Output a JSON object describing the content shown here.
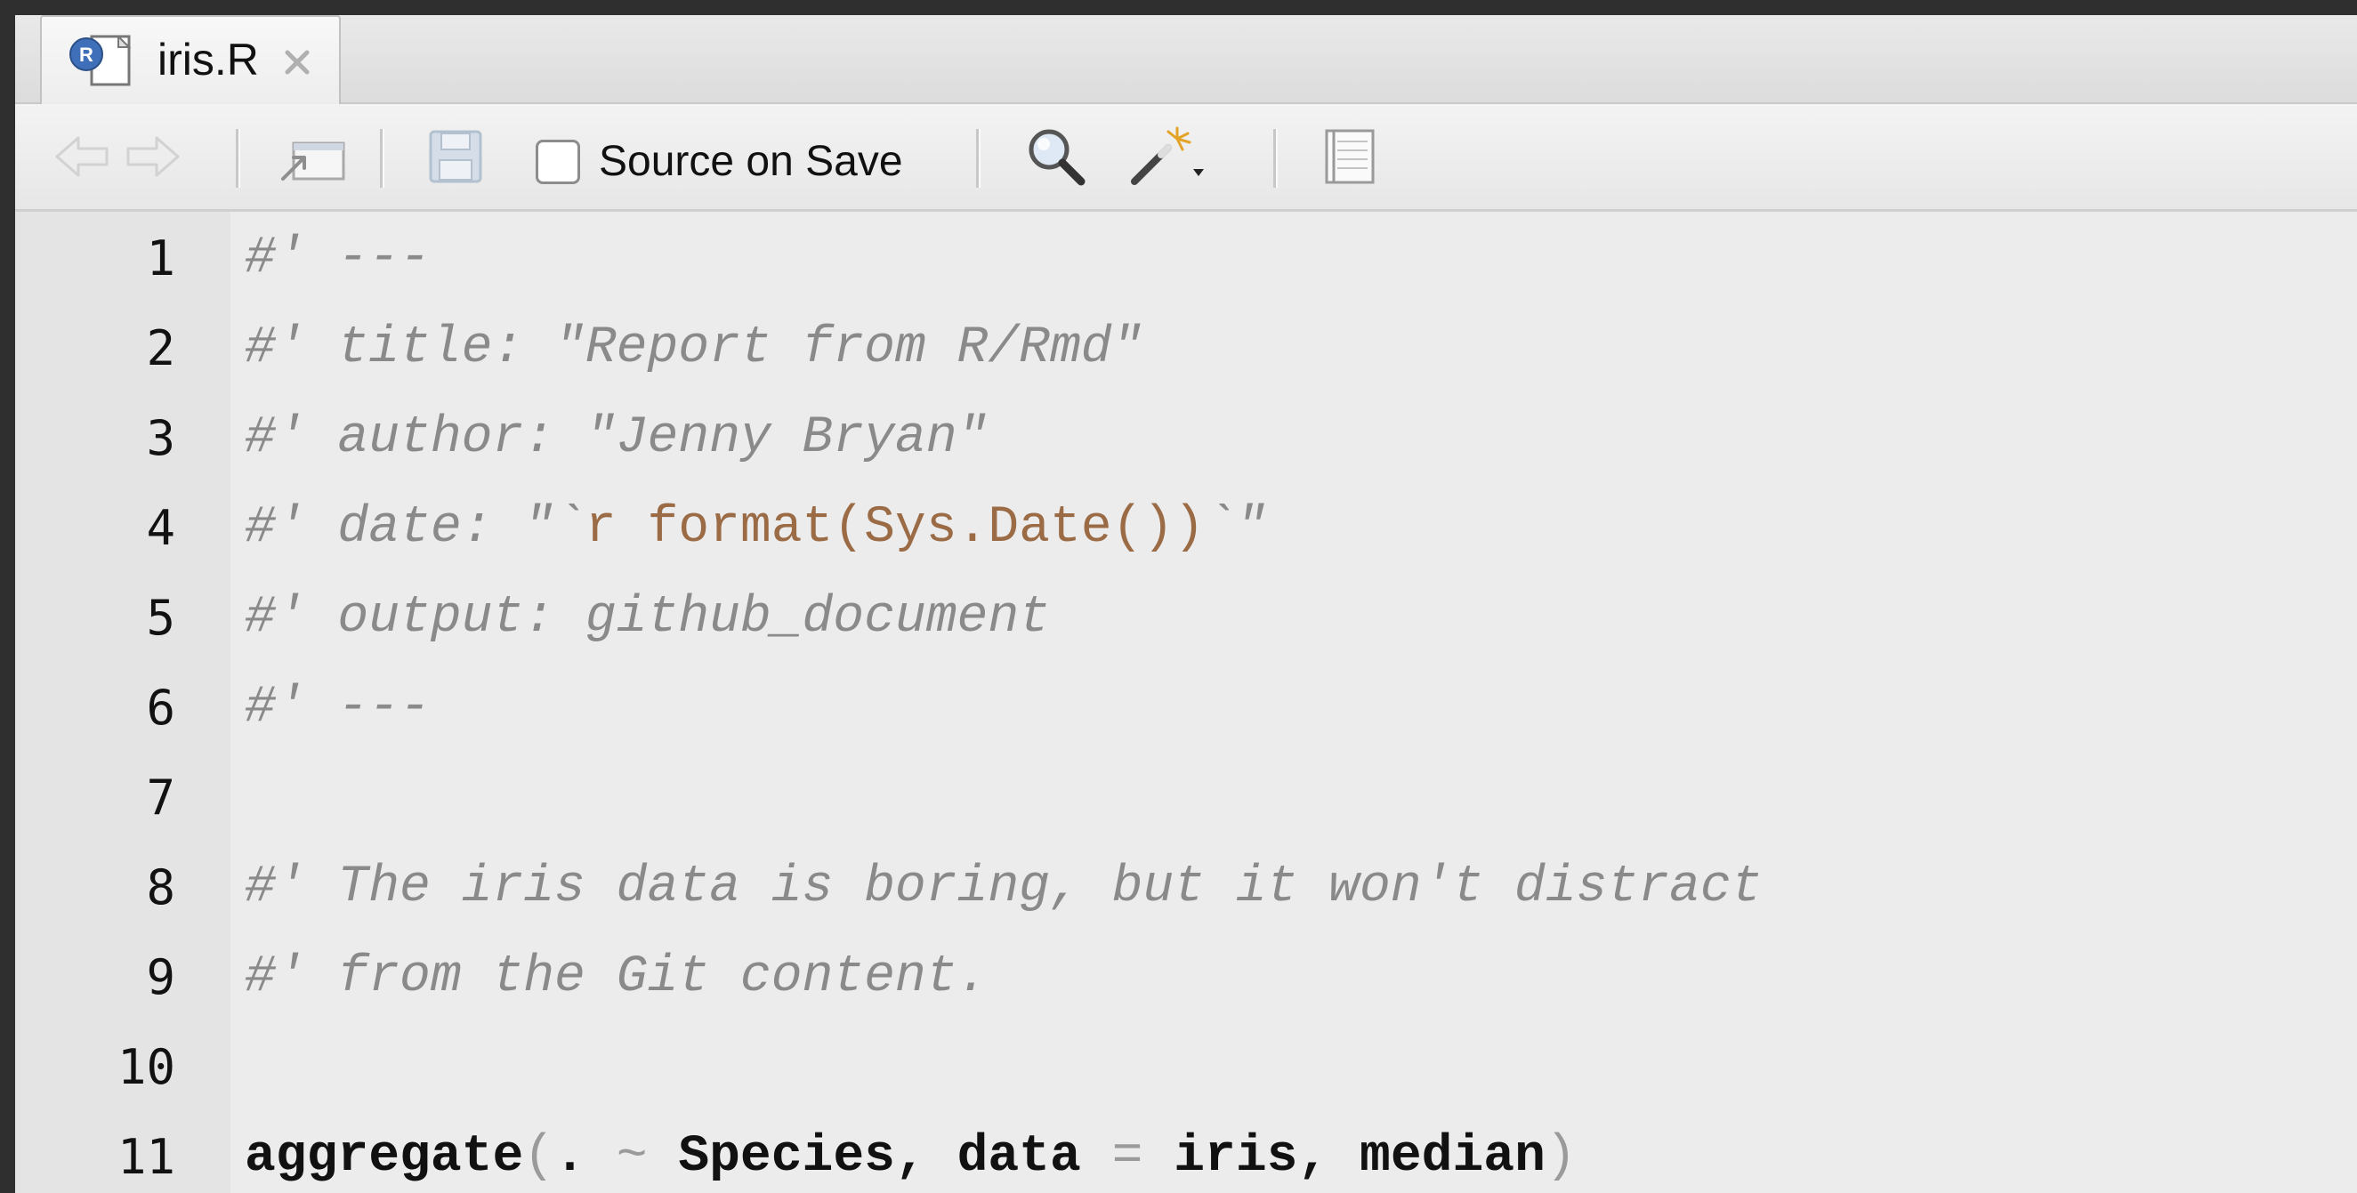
{
  "tab": {
    "filename": "iris.R",
    "close_symbol": "×"
  },
  "toolbar": {
    "back_icon": "arrow-left-icon",
    "forward_icon": "arrow-right-icon",
    "show_in_window_icon": "popout-icon",
    "save_icon": "save-icon",
    "source_on_save_label": "Source on Save",
    "source_on_save_checked": false,
    "search_icon": "magnifier-icon",
    "code_tools_icon": "magic-wand-icon",
    "compile_notebook_icon": "notebook-icon"
  },
  "editor": {
    "lines": [
      {
        "number": "1",
        "segments": [
          {
            "text": "#' ---",
            "kind": "comment"
          }
        ]
      },
      {
        "number": "2",
        "segments": [
          {
            "text": "#' title: \"Report from R/Rmd\"",
            "kind": "comment"
          }
        ]
      },
      {
        "number": "3",
        "segments": [
          {
            "text": "#' author: \"Jenny Bryan\"",
            "kind": "comment"
          }
        ]
      },
      {
        "number": "4",
        "segments": [
          {
            "text": "#' date: \"`",
            "kind": "comment"
          },
          {
            "text": "r format(Sys.Date())",
            "kind": "inline"
          },
          {
            "text": "`\"",
            "kind": "comment"
          }
        ]
      },
      {
        "number": "5",
        "segments": [
          {
            "text": "#' output: github_document",
            "kind": "comment"
          }
        ]
      },
      {
        "number": "6",
        "segments": [
          {
            "text": "#' ---",
            "kind": "comment"
          }
        ]
      },
      {
        "number": "7",
        "segments": []
      },
      {
        "number": "8",
        "segments": [
          {
            "text": "#' The iris data is boring, but it won't distract",
            "kind": "comment"
          }
        ]
      },
      {
        "number": "9",
        "segments": [
          {
            "text": "#' from the Git content.",
            "kind": "comment"
          }
        ]
      },
      {
        "number": "10",
        "segments": []
      },
      {
        "number": "11",
        "segments": [
          {
            "text": "aggregate",
            "kind": "fn"
          },
          {
            "text": "(",
            "kind": "op"
          },
          {
            "text": ". ",
            "kind": "fn"
          },
          {
            "text": "~",
            "kind": "op"
          },
          {
            "text": " Species, data ",
            "kind": "fn"
          },
          {
            "text": "=",
            "kind": "op"
          },
          {
            "text": " iris, median",
            "kind": "fn"
          },
          {
            "text": ")",
            "kind": "op"
          }
        ]
      }
    ]
  }
}
